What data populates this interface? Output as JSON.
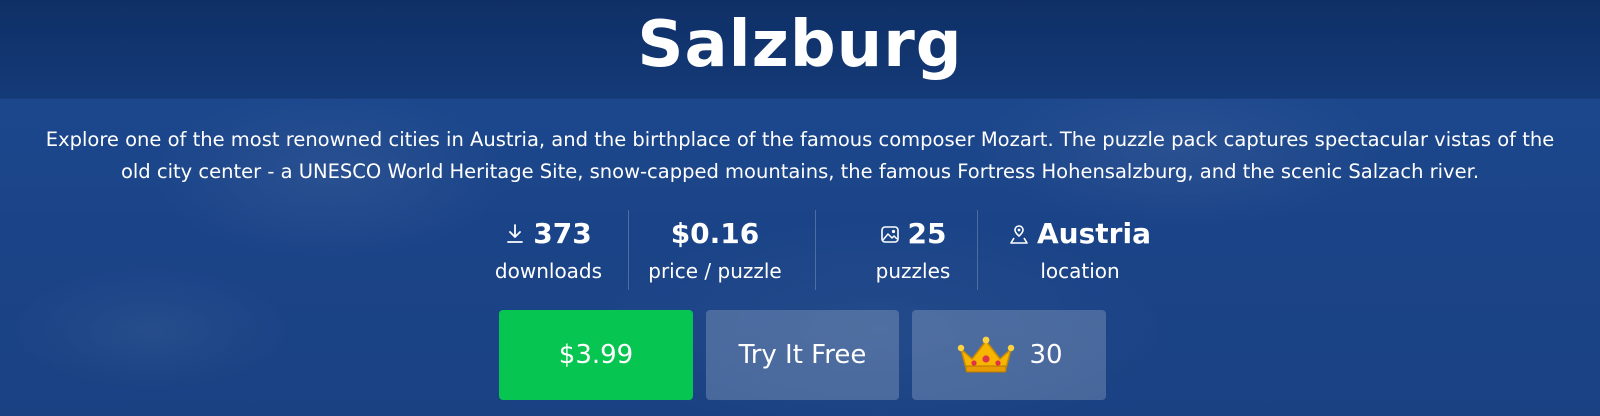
{
  "header": {
    "title": "Salzburg"
  },
  "description": "Explore one of the most renowned cities in Austria, and the birthplace of the famous composer Mozart. The puzzle pack captures spectacular vistas of the old city center - a UNESCO World Heritage Site, snow-capped mountains, the famous Fortress Hohensalzburg, and the scenic Salzach river.",
  "stats": {
    "downloads": {
      "value": "373",
      "label": "downloads",
      "icon": "download-icon"
    },
    "price": {
      "value": "$0.16",
      "label": "price / puzzle"
    },
    "puzzles": {
      "value": "25",
      "label": "puzzles",
      "icon": "image-icon"
    },
    "location": {
      "value": "Austria",
      "label": "location",
      "icon": "location-pin-icon"
    }
  },
  "buttons": {
    "buy": "$3.99",
    "try": "Try It Free",
    "crown_count": "30",
    "crown_icon": "crown-icon"
  },
  "colors": {
    "background": "#1c4589",
    "title_bar": "#0f2f66",
    "buy_button": "#06c651",
    "crown_gold": "#f7b500"
  }
}
